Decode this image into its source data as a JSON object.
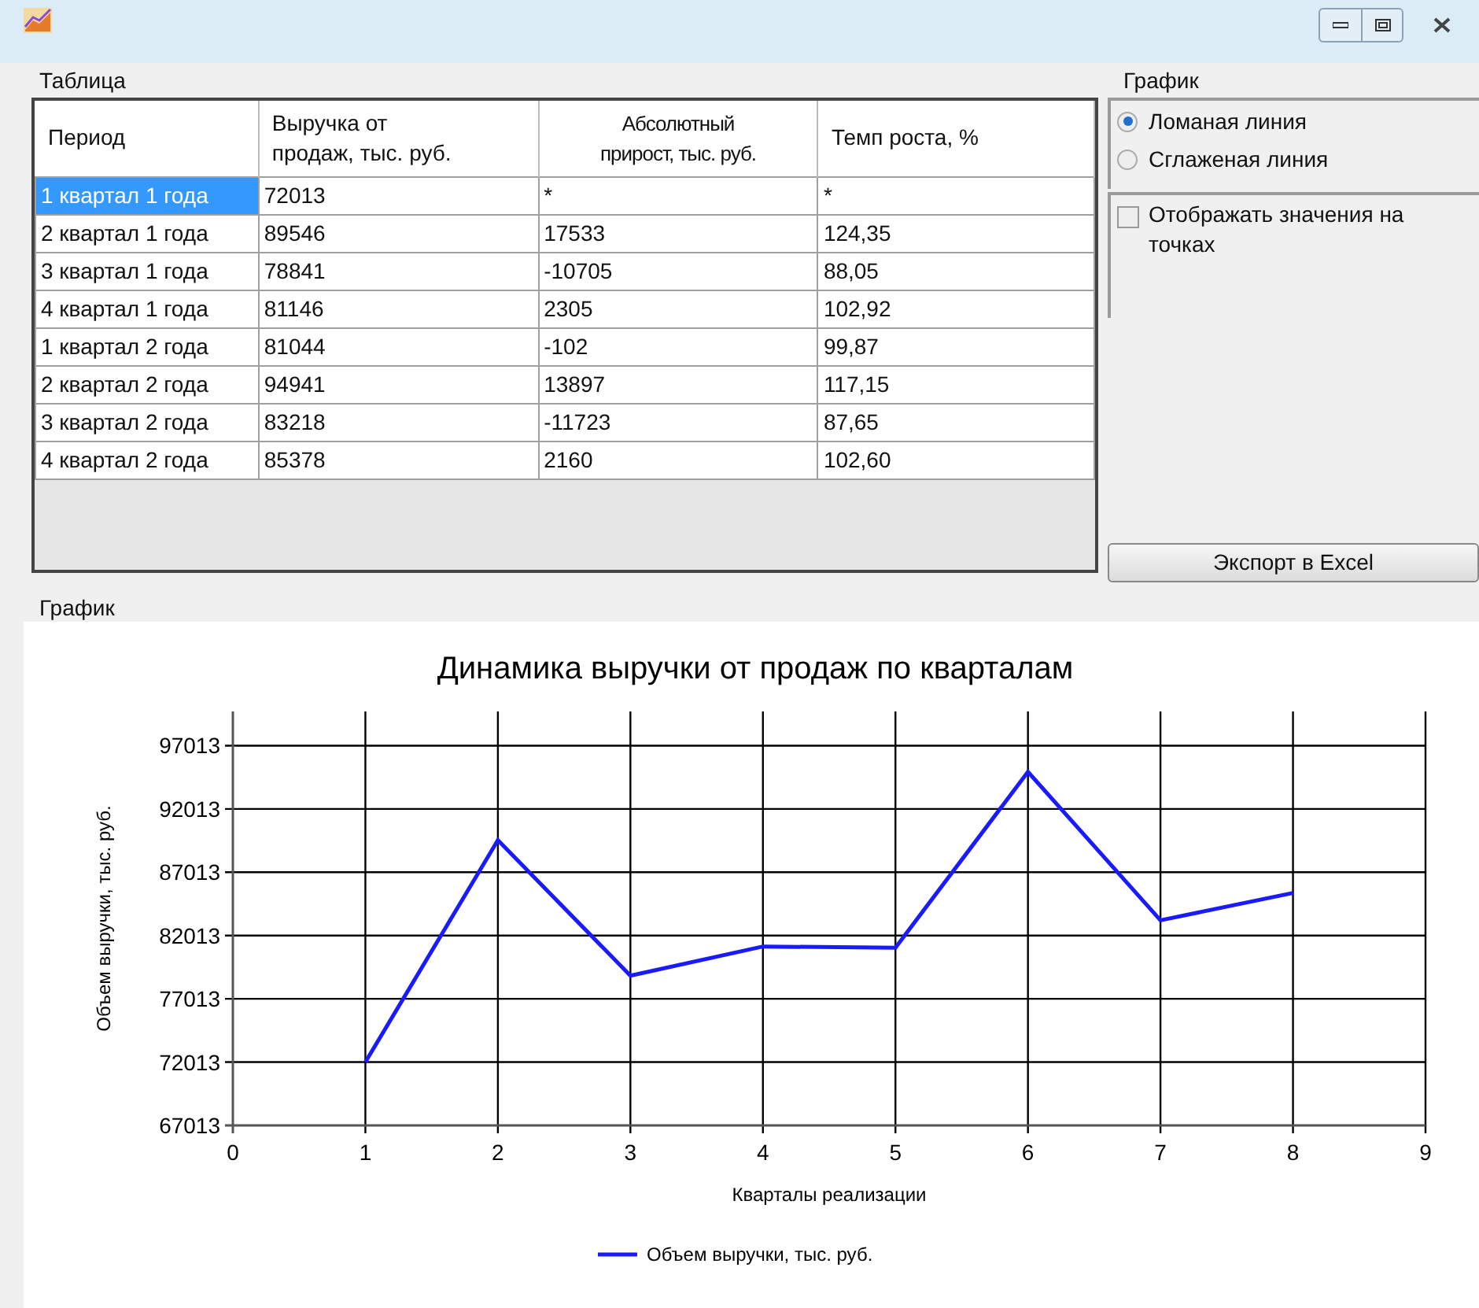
{
  "table_group": {
    "title": "Таблица",
    "columns": [
      "Период",
      "Выручка от продаж, тыс. руб.",
      "Абсолютный прирост, тыс. руб.",
      "Темп роста, %"
    ],
    "rows": [
      {
        "cells": [
          "1 квартал 1 года",
          "72013",
          "*",
          "*"
        ],
        "selected": true
      },
      {
        "cells": [
          "2 квартал 1 года",
          "89546",
          "17533",
          "124,35"
        ],
        "selected": false
      },
      {
        "cells": [
          "3 квартал 1 года",
          "78841",
          "-10705",
          "88,05"
        ],
        "selected": false
      },
      {
        "cells": [
          "4 квартал 1 года",
          "81146",
          "2305",
          "102,92"
        ],
        "selected": false
      },
      {
        "cells": [
          "1 квартал 2 года",
          "81044",
          "-102",
          "99,87"
        ],
        "selected": false
      },
      {
        "cells": [
          "2 квартал 2 года",
          "94941",
          "13897",
          "117,15"
        ],
        "selected": false
      },
      {
        "cells": [
          "3 квартал 2 года",
          "83218",
          "-11723",
          "87,65"
        ],
        "selected": false
      },
      {
        "cells": [
          "4 квартал 2 года",
          "85378",
          "2160",
          "102,60"
        ],
        "selected": false
      }
    ]
  },
  "options_group": {
    "title": "График",
    "line_types": [
      {
        "label": "Ломаная линия",
        "selected": true
      },
      {
        "label": "Сглаженая линия",
        "selected": false
      }
    ],
    "show_values": {
      "label": "Отображать значения на точках",
      "checked": false
    },
    "export_button": "Экспорт в Excel"
  },
  "chart_group": {
    "title": "График",
    "chart_data": {
      "type": "line",
      "title": "Динамика выручки от продаж по кварталам",
      "xlabel": "Кварталы реализации",
      "ylabel": "Объем выручки, тыс. руб.",
      "x": [
        1,
        2,
        3,
        4,
        5,
        6,
        7,
        8
      ],
      "series": [
        {
          "name": "Объем выручки, тыс. руб.",
          "color": "#1a1aff",
          "values": [
            72013,
            89546,
            78841,
            81146,
            81044,
            94941,
            83218,
            85378
          ]
        }
      ],
      "grid": true,
      "xlim": [
        0,
        9
      ],
      "ylim": [
        67013,
        99713
      ],
      "xticks": [
        0,
        1,
        2,
        3,
        4,
        5,
        6,
        7,
        8,
        9
      ],
      "yticks": [
        67013,
        72013,
        77013,
        82013,
        87013,
        92013,
        97013
      ]
    }
  }
}
